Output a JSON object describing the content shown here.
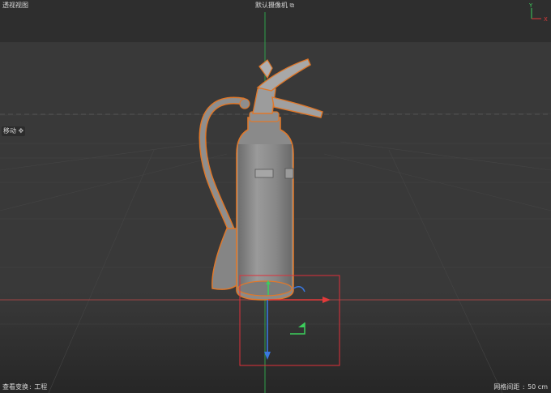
{
  "viewport": {
    "view_name": "透视视图",
    "camera_label": "默认摄像机",
    "camera_icon": "camera-link-icon",
    "active_tool": "移动",
    "active_tool_icon": "move-cross-icon",
    "status_left_label": "查看变换",
    "status_left_value": "工程",
    "status_right_label": "网格间距",
    "status_right_value": "50 cm"
  },
  "axis_gizmo": {
    "y_label": "Y",
    "x_label": "X"
  },
  "colors": {
    "selection_outline": "#e0782a",
    "axis_x": "#e23a3a",
    "axis_y": "#3ccf5c",
    "axis_z": "#3a78e0",
    "selection_box": "#e0303a"
  }
}
